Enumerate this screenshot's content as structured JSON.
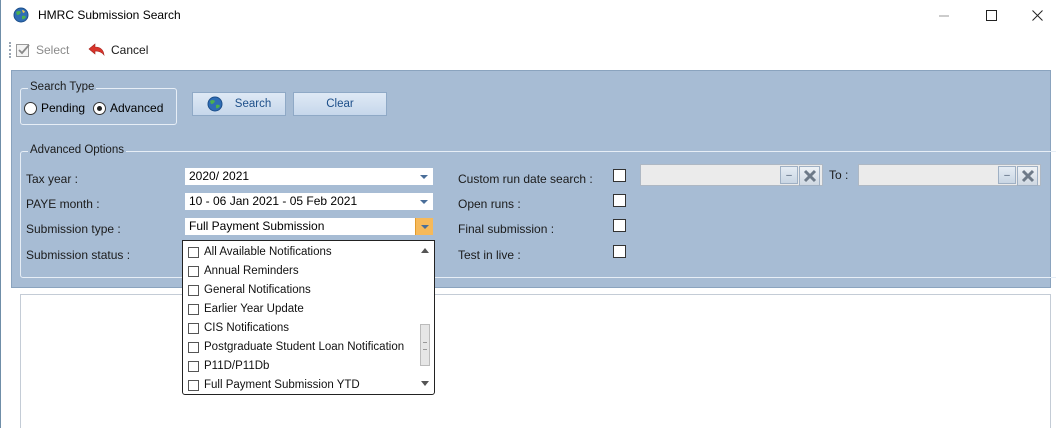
{
  "window": {
    "title": "HMRC Submission Search",
    "icon": "hmrc-globe-icon",
    "controls": [
      "minimize",
      "maximize",
      "close"
    ]
  },
  "toolbar": {
    "select_label": "Select",
    "cancel_label": "Cancel"
  },
  "search_type": {
    "legend": "Search Type",
    "options": [
      {
        "label": "Pending",
        "selected": false
      },
      {
        "label": "Advanced",
        "selected": true
      }
    ],
    "search_button": "Search",
    "clear_button": "Clear"
  },
  "advanced": {
    "legend": "Advanced Options",
    "tax_year": {
      "label": "Tax year :",
      "value": "2020/ 2021"
    },
    "paye_month": {
      "label": "PAYE month :",
      "value": "10 - 06 Jan 2021 - 05 Feb 2021"
    },
    "submission_type": {
      "label": "Submission type :",
      "value": "Full Payment Submission"
    },
    "submission_status": {
      "label": "Submission status :"
    },
    "custom_run_date": {
      "label": "Custom run date search :",
      "checked": false,
      "from_value": "",
      "to_label": "To :",
      "to_value": ""
    },
    "open_runs": {
      "label": "Open runs :",
      "checked": false
    },
    "final_submission": {
      "label": "Final submission :",
      "checked": false
    },
    "test_in_live": {
      "label": "Test in live :",
      "checked": false
    }
  },
  "dropdown": {
    "items": [
      {
        "label": "All Available Notifications",
        "checked": false
      },
      {
        "label": "Annual Reminders",
        "checked": false
      },
      {
        "label": "General Notifications",
        "checked": false
      },
      {
        "label": "Earlier Year Update",
        "checked": false
      },
      {
        "label": "CIS Notifications",
        "checked": false
      },
      {
        "label": "Postgraduate Student Loan Notification",
        "checked": false
      },
      {
        "label": "P11D/P11Db",
        "checked": false
      },
      {
        "label": "Full Payment Submission YTD",
        "checked": false
      }
    ]
  },
  "colors": {
    "panel_bg": "#a7bcd4",
    "dropdown_arrow_active": "#f6b95a",
    "button_text": "#1d4f8a"
  }
}
